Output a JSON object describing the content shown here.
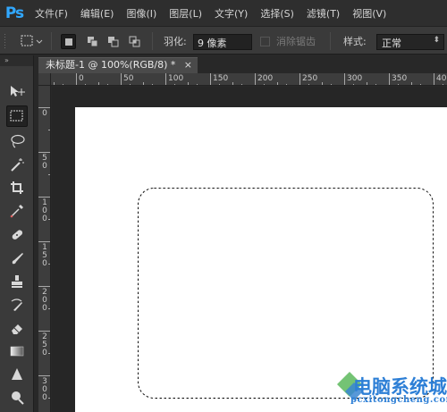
{
  "app": {
    "logo": "Ps",
    "name": "Photoshop"
  },
  "menu": [
    "文件(F)",
    "编辑(E)",
    "图像(I)",
    "图层(L)",
    "文字(Y)",
    "选择(S)",
    "滤镜(T)",
    "视图(V)"
  ],
  "options": {
    "feather_label": "羽化:",
    "feather_value": "9 像素",
    "antialias_label": "消除锯齿",
    "style_label": "样式:",
    "style_value": "正常"
  },
  "toolbox": {
    "header": "»",
    "tools": [
      "move-tool",
      "rectangular-marquee-tool",
      "lasso-tool",
      "magic-wand-tool",
      "crop-tool",
      "eyedropper-tool",
      "spot-healing-tool",
      "brush-tool",
      "clone-stamp-tool",
      "history-brush-tool",
      "eraser-tool",
      "gradient-tool",
      "blur-tool",
      "dodge-tool"
    ]
  },
  "document": {
    "tab_title": "未标题-1 @ 100%(RGB/8) *",
    "close_glyph": "×"
  },
  "ruler": {
    "top_labels": [
      "0",
      "50",
      "100",
      "150",
      "200",
      "250",
      "300",
      "350",
      "400"
    ],
    "left_labels": [
      "0",
      "5\n0",
      "1\n0\n0",
      "1\n5\n0",
      "2\n0\n0",
      "2\n5\n0",
      "3\n0\n0"
    ]
  },
  "colors": {
    "accent": "#31a8ff",
    "canvas": "#ffffff",
    "panel": "#3a3a3a",
    "watermark": "#2d7fd6"
  },
  "watermark": {
    "title": "电脑系统城",
    "url": "pcxitongcheng.com"
  }
}
